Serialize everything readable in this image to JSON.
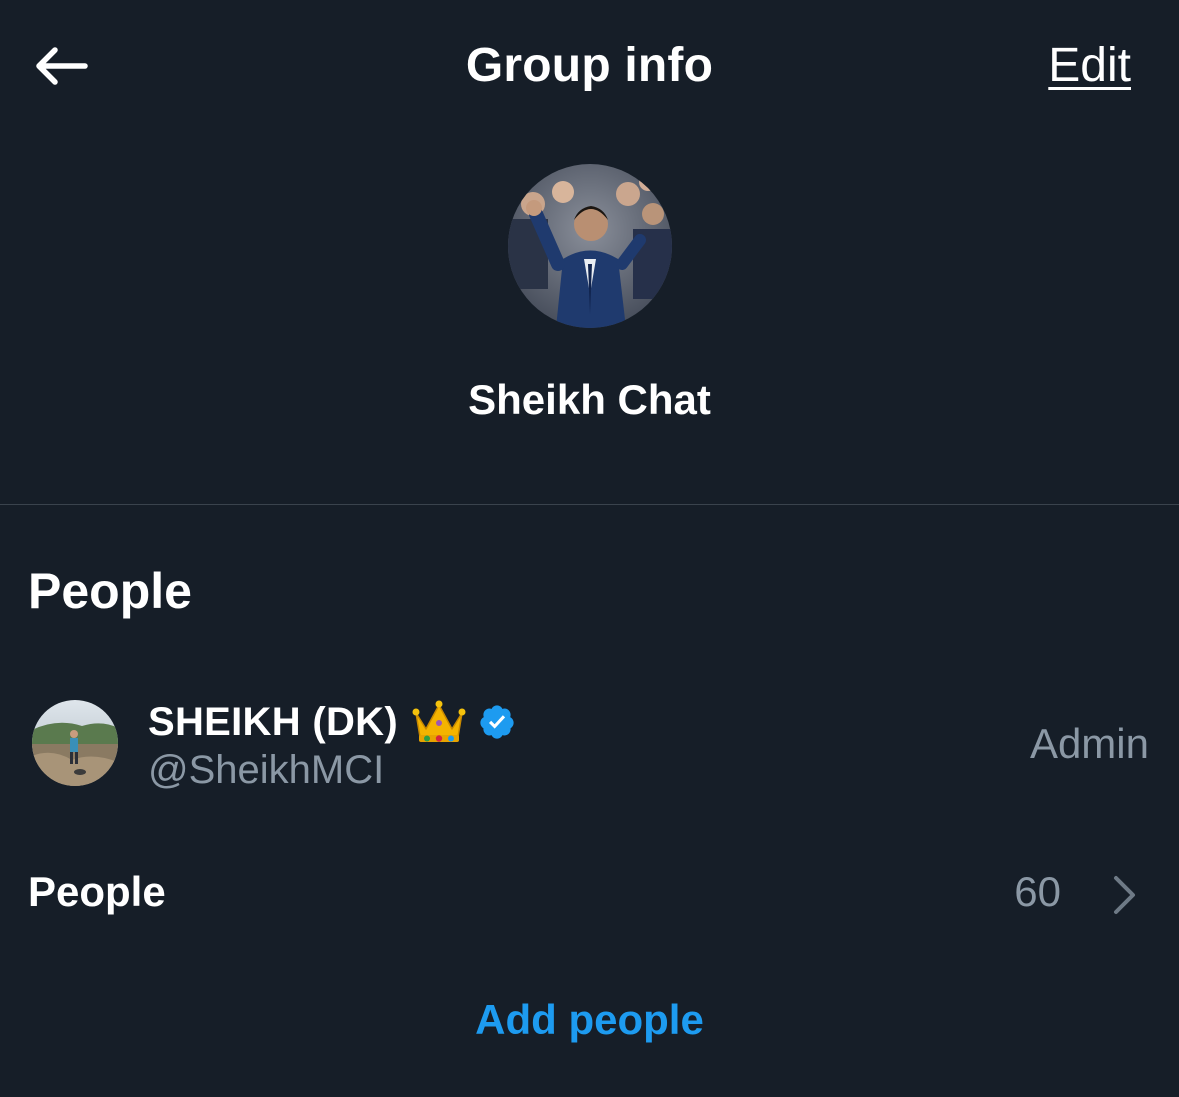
{
  "header": {
    "title": "Group info",
    "edit_label": "Edit",
    "back_icon": "arrow-left-icon"
  },
  "group": {
    "name": "Sheikh Chat",
    "avatar_description": "group-avatar-photo"
  },
  "people_section": {
    "title": "People",
    "members": [
      {
        "display_name": "SHEIKH (DK)",
        "emoji": "crown",
        "verified": true,
        "handle": "@SheikhMCI",
        "role": "Admin"
      }
    ],
    "people_label": "People",
    "people_count": "60",
    "add_people_label": "Add people"
  },
  "colors": {
    "background": "#161e28",
    "accent": "#1d9bf0",
    "secondary_text": "#8b98a5",
    "divider": "#3a434d"
  }
}
